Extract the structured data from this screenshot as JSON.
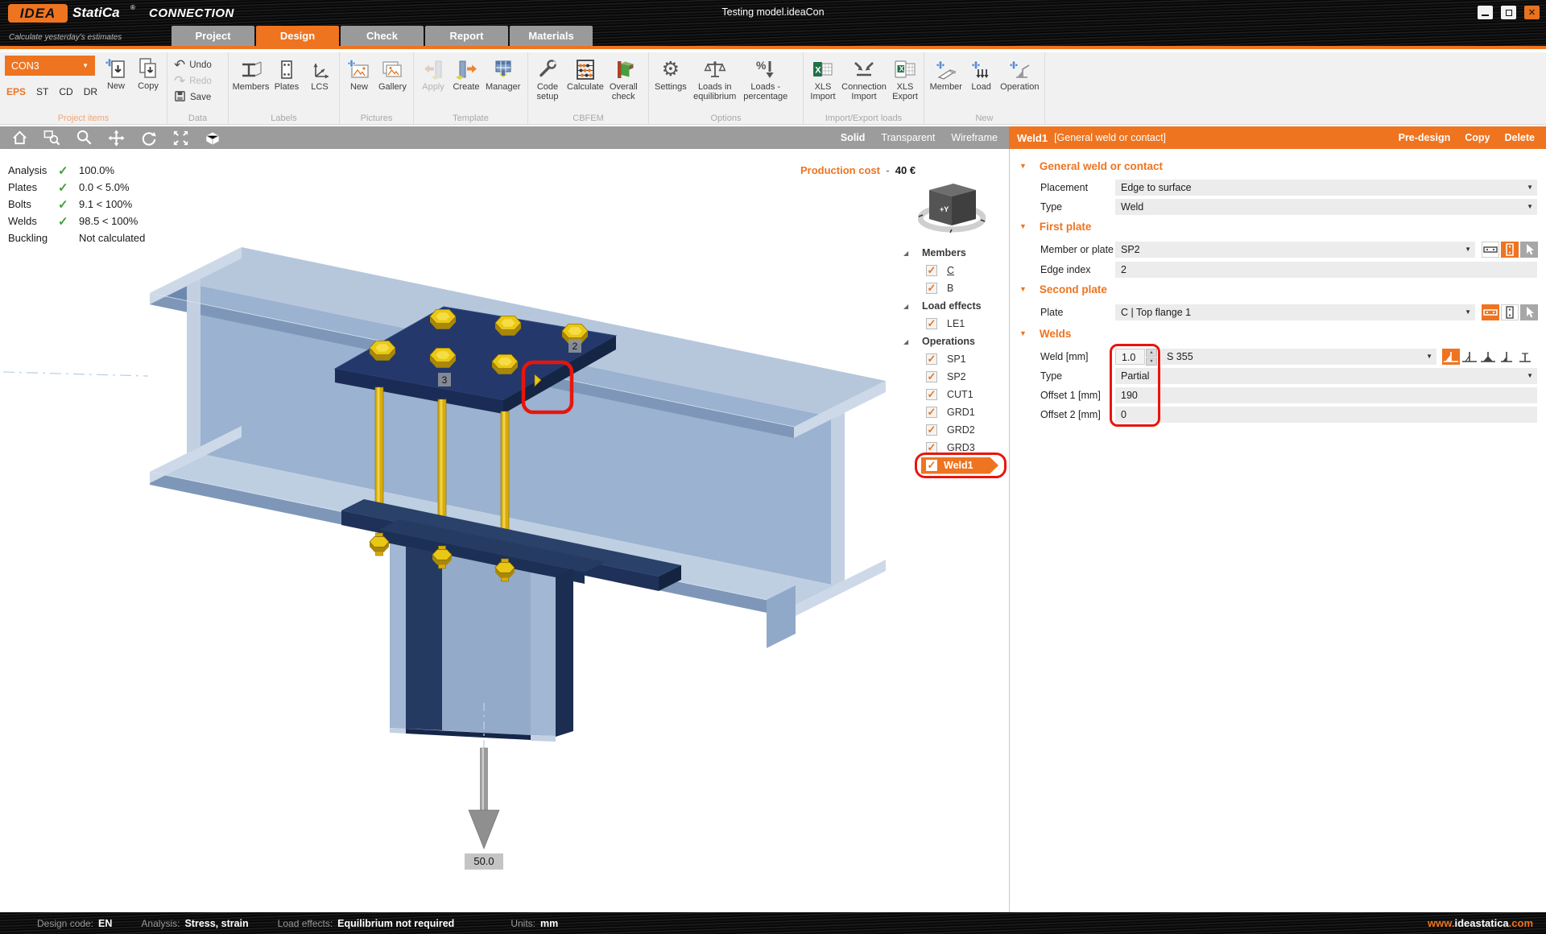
{
  "window": {
    "brand": "IDEA",
    "brand2": "StatiCa",
    "registered": "®",
    "app": "CONNECTION",
    "tagline": "Calculate yesterday's estimates",
    "title": "Testing model.ideaCon",
    "website_prefix": "www.",
    "website_name": "ideastatica",
    "website_suffix": ".com"
  },
  "tabs": [
    {
      "label": "Project"
    },
    {
      "label": "Design"
    },
    {
      "label": "Check"
    },
    {
      "label": "Report"
    },
    {
      "label": "Materials"
    }
  ],
  "project_items": {
    "group_label": "Project items",
    "selector_value": "CON3",
    "modes": [
      {
        "label": "EPS"
      },
      {
        "label": "ST"
      },
      {
        "label": "CD"
      },
      {
        "label": "DR"
      }
    ],
    "new_label": "New",
    "copy_label": "Copy"
  },
  "ribbon": {
    "data": {
      "label": "Data",
      "undo": "Undo",
      "redo": "Redo",
      "save": "Save"
    },
    "labels": {
      "label": "Labels",
      "members": "Members",
      "plates": "Plates",
      "lcs": "LCS"
    },
    "pictures": {
      "label": "Pictures",
      "new": "New",
      "gallery": "Gallery"
    },
    "template": {
      "label": "Template",
      "apply": "Apply",
      "create": "Create",
      "manager": "Manager"
    },
    "cbfem": {
      "label": "CBFEM",
      "code1": "Code",
      "code2": "setup",
      "calculate": "Calculate",
      "overall1": "Overall",
      "overall2": "check"
    },
    "options": {
      "label": "Options",
      "settings": "Settings",
      "eq1": "Loads in",
      "eq2": "equilibrium",
      "pct1": "Loads -",
      "pct2": "percentage"
    },
    "impexp": {
      "label": "Import/Export loads",
      "xlsi1": "XLS",
      "xlsi2": "Import",
      "conn1": "Connection",
      "conn2": "Import",
      "xlse1": "XLS",
      "xlse2": "Export"
    },
    "newgrp": {
      "label": "New",
      "member": "Member",
      "load": "Load",
      "operation": "Operation"
    }
  },
  "viewport_toolbar": {
    "solid": "Solid",
    "transparent": "Transparent",
    "wireframe": "Wireframe"
  },
  "analysis": {
    "rows": [
      {
        "label": "Analysis",
        "check": "✓",
        "value": "100.0%"
      },
      {
        "label": "Plates",
        "check": "✓",
        "value": "0.0 < 5.0%"
      },
      {
        "label": "Bolts",
        "check": "✓",
        "value": "9.1 < 100%"
      },
      {
        "label": "Welds",
        "check": "✓",
        "value": "98.5 < 100%"
      },
      {
        "label": "Buckling",
        "check": "",
        "value": "Not calculated"
      }
    ]
  },
  "viewport": {
    "production_cost_label": "Production cost",
    "production_cost_sep": "-",
    "production_cost_value": "40 €",
    "load_value": "50.0",
    "label_2": "2",
    "label_3": "3",
    "cube_axis": "+Y"
  },
  "tree": {
    "members_header": "Members",
    "member_c": "C",
    "member_b": "B",
    "loads_header": "Load effects",
    "le1": "LE1",
    "operations_header": "Operations",
    "operations": [
      {
        "label": "SP1"
      },
      {
        "label": "SP2"
      },
      {
        "label": "CUT1"
      },
      {
        "label": "GRD1"
      },
      {
        "label": "GRD2"
      },
      {
        "label": "GRD3"
      }
    ],
    "weld": "Weld1"
  },
  "properties": {
    "header": {
      "title": "Weld1",
      "subtitle": "[General weld or contact]",
      "predesign": "Pre-design",
      "copy": "Copy",
      "delete": "Delete"
    },
    "general": {
      "title": "General weld or contact",
      "placement_label": "Placement",
      "placement_value": "Edge to surface",
      "type_label": "Type",
      "type_value": "Weld"
    },
    "first_plate": {
      "title": "First plate",
      "member_label": "Member or plate",
      "member_value": "SP2",
      "edge_label": "Edge index",
      "edge_value": "2"
    },
    "second_plate": {
      "title": "Second plate",
      "plate_label": "Plate",
      "plate_value": "C | Top flange 1"
    },
    "welds": {
      "title": "Welds",
      "weld_label": "Weld [mm]",
      "weld_value": "1.0",
      "material": "S 355",
      "type_label": "Type",
      "type_value": "Partial",
      "offset1_label": "Offset 1 [mm]",
      "offset1_value": "190",
      "offset2_label": "Offset 2 [mm]",
      "offset2_value": "0"
    }
  },
  "status": {
    "design_code_label": "Design code:",
    "design_code": "EN",
    "analysis_label": "Analysis:",
    "analysis": "Stress, strain",
    "load_label": "Load effects:",
    "load": "Equilibrium not required",
    "units_label": "Units:",
    "units": "mm"
  },
  "icons": {
    "caret": "▼",
    "tri": "▼",
    "expander": "◢",
    "check": "✓",
    "spin_up": "▲",
    "spin_down": "▼",
    "undo": "↶",
    "redo": "↷",
    "gear": "⚙"
  },
  "colors": {
    "accent": "#ee7420",
    "annotation": "#e8150d",
    "check_green": "#3da13d",
    "steel": "#9bb2d0",
    "navy": "#24386b",
    "bolt": "#e9c715"
  }
}
